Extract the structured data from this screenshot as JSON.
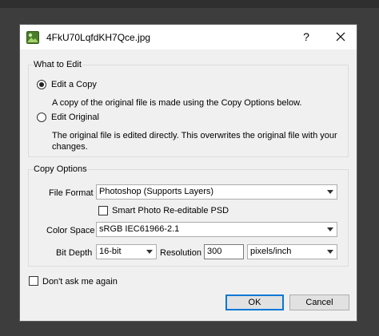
{
  "window": {
    "title": "4FkU70LqfdKH7Qce.jpg",
    "help_glyph": "?",
    "app_icon": "photo-app-icon",
    "close_icon": "close-icon"
  },
  "what_to_edit": {
    "group_label": "What to Edit",
    "edit_copy": {
      "label": "Edit a Copy",
      "selected": true,
      "description": "A copy of the original file is made using the Copy Options below."
    },
    "edit_original": {
      "label": "Edit Original",
      "selected": false,
      "description": "The original file is edited directly.  This overwrites the original file with your changes."
    }
  },
  "copy_options": {
    "group_label": "Copy Options",
    "file_format": {
      "label": "File Format",
      "value": "Photoshop (Supports Layers)"
    },
    "smart_photo": {
      "label": "Smart Photo Re-editable PSD",
      "checked": false
    },
    "color_space": {
      "label": "Color Space",
      "value": "sRGB IEC61966-2.1"
    },
    "bit_depth": {
      "label": "Bit Depth",
      "value": "16-bit"
    },
    "resolution": {
      "label": "Resolution",
      "value": "300",
      "unit": "pixels/inch"
    }
  },
  "dont_ask": {
    "label": "Don't ask me again",
    "checked": false
  },
  "buttons": {
    "ok": "OK",
    "cancel": "Cancel"
  },
  "colors": {
    "accent": "#0078d7",
    "dialog_bg": "#f0f0f0",
    "backdrop": "#3d3d3d"
  }
}
